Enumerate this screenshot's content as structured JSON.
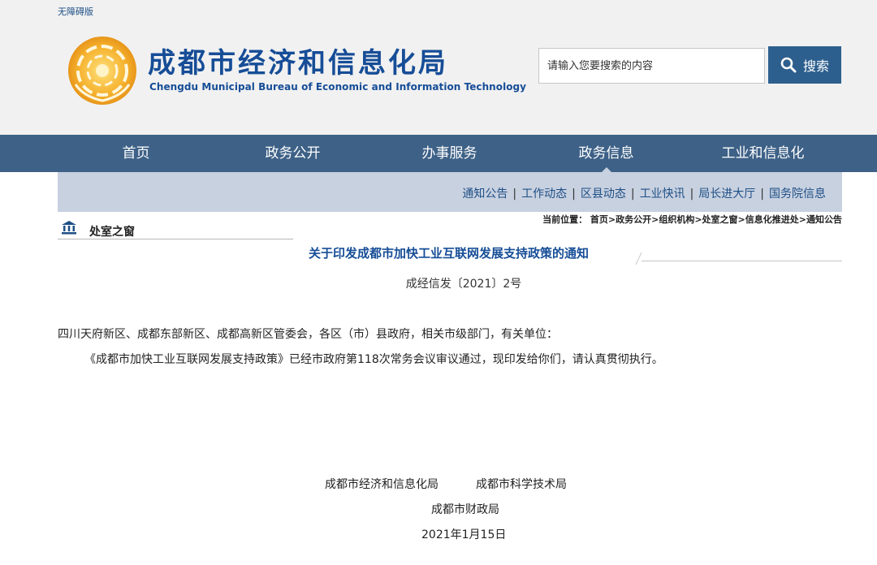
{
  "header": {
    "accessibility_link": "无障碍版",
    "title": "成都市经济和信息化局",
    "subtitle": "Chengdu Municipal Bureau of Economic and Information Technology",
    "search_placeholder": "请输入您要搜索的内容",
    "search_button": "搜索"
  },
  "nav": {
    "items": [
      {
        "label": "首页"
      },
      {
        "label": "政务公开"
      },
      {
        "label": "办事服务"
      },
      {
        "label": "政务信息"
      },
      {
        "label": "工业和信息化"
      }
    ],
    "active": "政务信息"
  },
  "subnav": {
    "items": [
      "通知公告",
      "工作动态",
      "区县动态",
      "工业快讯",
      "局长进大厅",
      "国务院信息"
    ],
    "separator": "|"
  },
  "sidebar": {
    "section_title": "处室之窗"
  },
  "breadcrumb": "当前位置： 首页>政务公开>组织机构>处室之窗>信息化推进处>通知公告",
  "document": {
    "title": "关于印发成都市加快工业互联网发展支持政策的通知",
    "number": "成经信发〔2021〕2号",
    "recipients": "四川天府新区、成都东部新区、成都高新区管委会，各区（市）县政府，相关市级部门，有关单位：",
    "body": "《成都市加快工业互联网发展支持政策》已经市政府第118次常务会议审议通过，现印发给你们，请认真贯彻执行。",
    "signatories": [
      "成都市经济和信息化局",
      "成都市科学技术局",
      "成都市财政局"
    ],
    "date": "2021年1月15日"
  },
  "colors": {
    "brand_blue": "#164d97",
    "nav_bg": "#3e6187",
    "subnav_bg": "#c8d1e0",
    "header_bg": "#f1f1f1",
    "logo_gold": "#f0a92a"
  },
  "icons": {
    "logo": "sun-emblem-logo",
    "search": "search-icon",
    "section": "government-building-icon"
  }
}
